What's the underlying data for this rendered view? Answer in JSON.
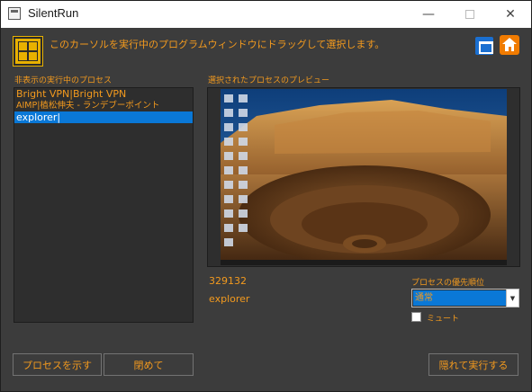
{
  "window": {
    "title": "SilentRun",
    "minimize_glyph": "—",
    "close_glyph": "✕"
  },
  "header": {
    "instruction": "このカーソルを実行中のプログラムウィンドウにドラッグして選択します。"
  },
  "labels": {
    "hidden_processes": "非表示の実行中のプロセス",
    "preview": "選択されたプロセスのプレビュー",
    "priority": "プロセスの優先順位",
    "mute": "ミュート"
  },
  "process_list": [
    {
      "text": "Bright VPN|Bright VPN"
    },
    {
      "text": "AIMP|植松伸夫 - ランデブーポイント"
    },
    {
      "text": "explorer|"
    }
  ],
  "selected_process": {
    "pid": "329132",
    "name": "explorer"
  },
  "priority": {
    "value": "通常"
  },
  "buttons": {
    "show": "プロセスを示す",
    "close": "閉めて",
    "run_hidden": "隠れて実行する"
  },
  "colors": {
    "accent": "#f39a1e",
    "selection": "#0a78d7",
    "background": "#3c3c3c"
  }
}
